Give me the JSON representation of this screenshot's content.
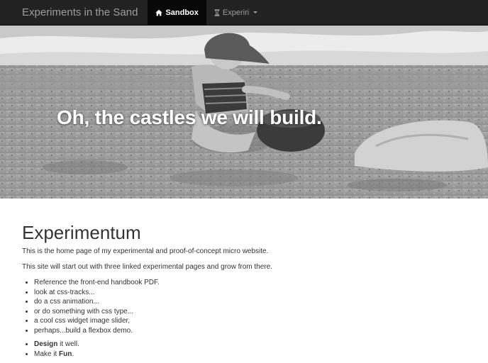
{
  "navbar": {
    "brand": "Experiments in the Sand",
    "items": [
      {
        "label": "Sandbox",
        "icon": "home-icon",
        "active": true
      },
      {
        "label": "Experiri",
        "icon": "hourglass-icon",
        "has_dropdown": true
      }
    ]
  },
  "hero": {
    "title": "Oh, the castles we will build."
  },
  "main": {
    "title": "Experimentum",
    "paragraphs": [
      "This is the home page of my experimental and proof-of-concept micro website.",
      "This site will start out with three linked experimental pages and grow from there."
    ],
    "list": [
      "Reference the front-end handbook PDF.",
      "look at css-tracks...",
      "do a css animation...",
      "or do something with css type...",
      "a cool css widget image slider,",
      "perhaps...build a flexbox demo."
    ],
    "list2": [
      {
        "bold": "Design",
        "rest": " it well."
      },
      {
        "plain": "Make it ",
        "bold": "Fun",
        "rest": "."
      }
    ]
  },
  "colors": {
    "navbar_bg": "#222222",
    "navbar_text": "#9d9d9d",
    "active_bg": "#080808",
    "hero_text": "#ffffff",
    "body_text": "#333333"
  }
}
